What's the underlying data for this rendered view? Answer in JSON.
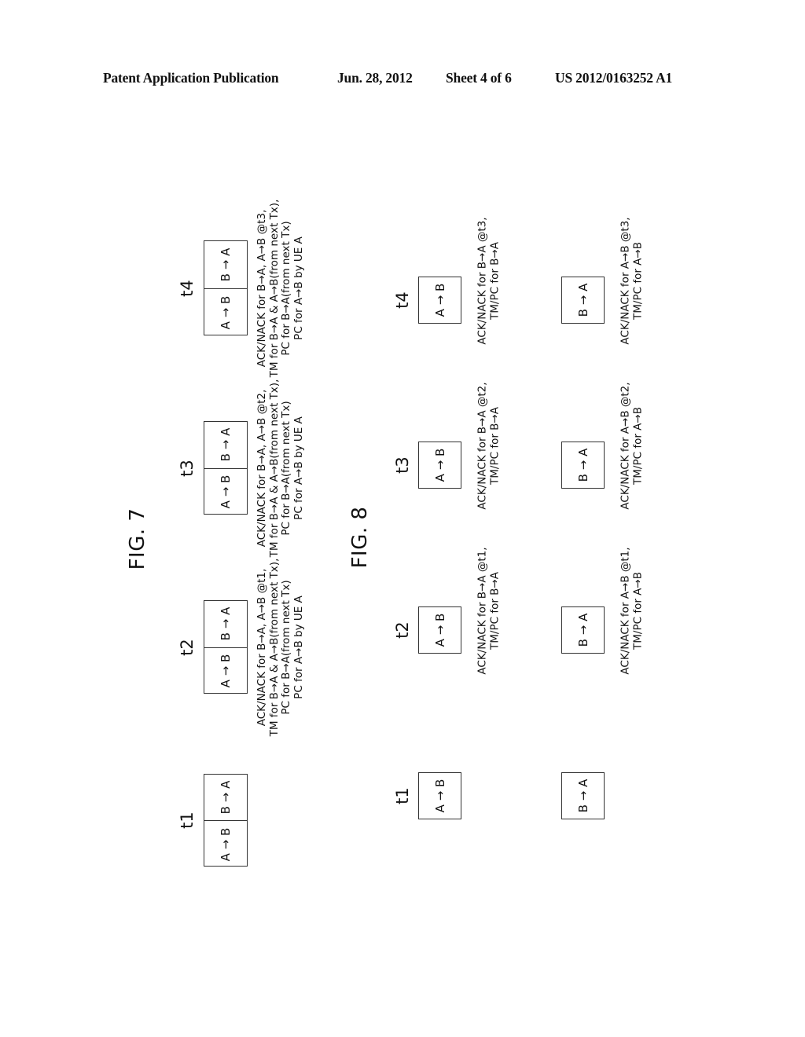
{
  "header": {
    "publication": "Patent Application Publication",
    "date": "Jun. 28, 2012",
    "sheet": "Sheet 4 of 6",
    "number": "US 2012/0163252 A1"
  },
  "fig7": {
    "title": "FIG. 7",
    "slots": [
      {
        "label": "t1",
        "cells": [
          "A → B",
          "B → A"
        ],
        "note": []
      },
      {
        "label": "t2",
        "cells": [
          "A → B",
          "B → A"
        ],
        "note": [
          "ACK/NACK for B→A, A→B @t1,",
          "TM for B→A & A→B(from next Tx),",
          "PC for B→A(from next Tx)",
          "PC for A→B by UE A"
        ]
      },
      {
        "label": "t3",
        "cells": [
          "A → B",
          "B → A"
        ],
        "note": [
          "ACK/NACK for B→A, A→B @t2,",
          "TM for B→A & A→B(from next Tx),",
          "PC for B→A(from next Tx)",
          "PC for A→B by UE A"
        ]
      },
      {
        "label": "t4",
        "cells": [
          "A → B",
          "B → A"
        ],
        "note": [
          "ACK/NACK for B→A, A→B @t3,",
          "TM for B→A & A→B(from next Tx),",
          "PC for B→A(from next Tx)",
          "PC for A→B by UE A"
        ]
      }
    ]
  },
  "fig8": {
    "title": "FIG. 8",
    "slots": [
      {
        "label": "t1",
        "upper": {
          "cell": "A → B",
          "note": []
        },
        "lower": {
          "cell": "B → A",
          "note": []
        }
      },
      {
        "label": "t2",
        "upper": {
          "cell": "A → B",
          "note": [
            "ACK/NACK for B→A @t1,",
            "TM/PC for B→A"
          ]
        },
        "lower": {
          "cell": "B → A",
          "note": [
            "ACK/NACK for A→B @t1,",
            "TM/PC for A→B"
          ]
        }
      },
      {
        "label": "t3",
        "upper": {
          "cell": "A → B",
          "note": [
            "ACK/NACK for B→A @t2,",
            "TM/PC for B→A"
          ]
        },
        "lower": {
          "cell": "B → A",
          "note": [
            "ACK/NACK for A→B @t2,",
            "TM/PC for A→B"
          ]
        }
      },
      {
        "label": "t4",
        "upper": {
          "cell": "A → B",
          "note": [
            "ACK/NACK for B→A @t3,",
            "TM/PC for B→A"
          ]
        },
        "lower": {
          "cell": "B → A",
          "note": [
            "ACK/NACK for A→B @t3,",
            "TM/PC for A→B"
          ]
        }
      }
    ]
  }
}
